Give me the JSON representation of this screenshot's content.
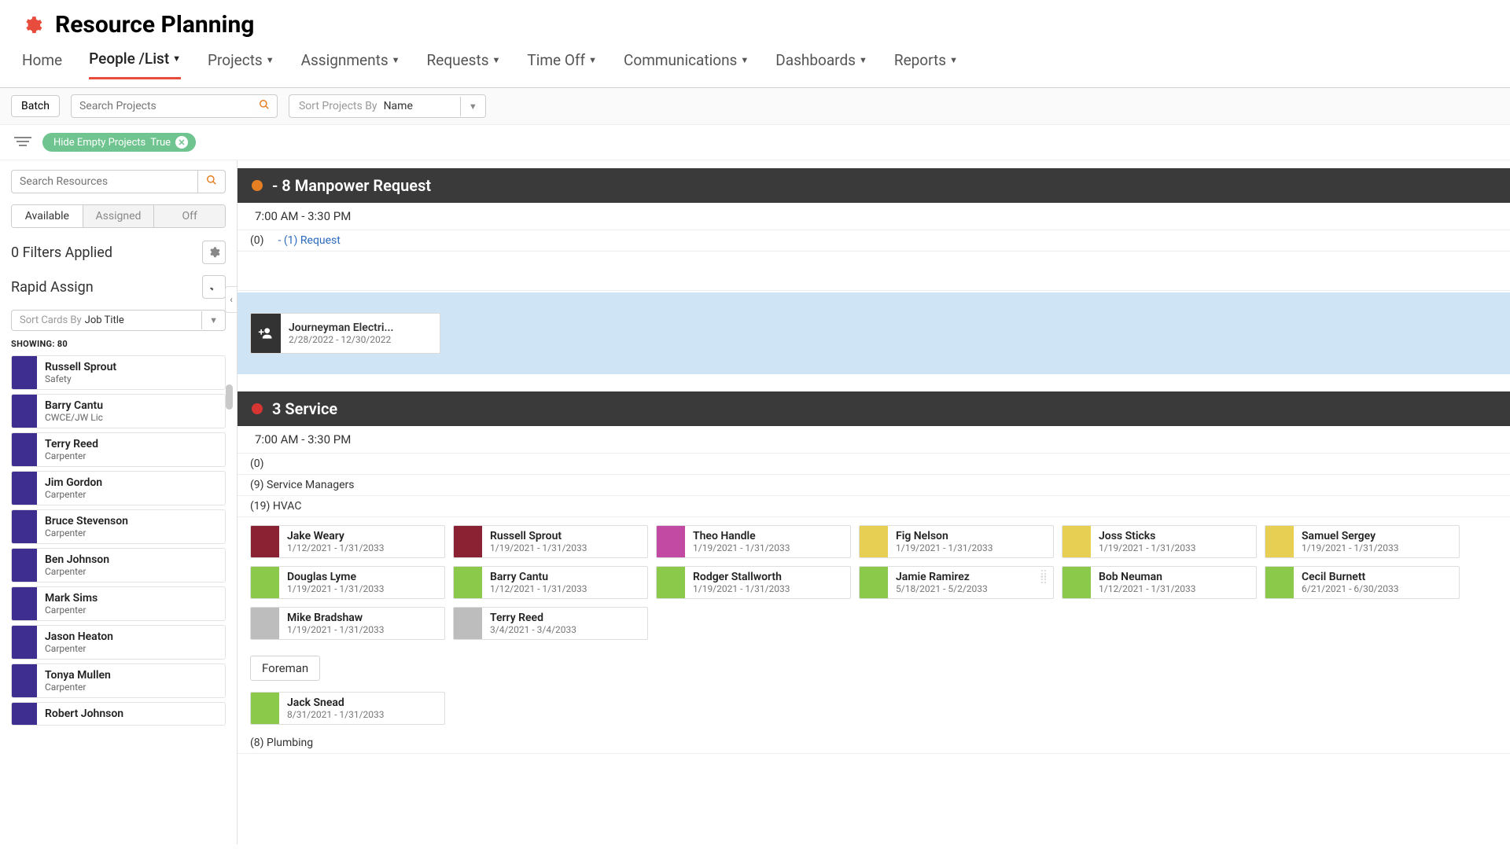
{
  "header": {
    "title": "Resource Planning"
  },
  "nav": {
    "items": [
      {
        "label": "Home",
        "dropdown": false
      },
      {
        "label": "People /List",
        "dropdown": true,
        "active": true
      },
      {
        "label": "Projects",
        "dropdown": true
      },
      {
        "label": "Assignments",
        "dropdown": true
      },
      {
        "label": "Requests",
        "dropdown": true
      },
      {
        "label": "Time Off",
        "dropdown": true
      },
      {
        "label": "Communications",
        "dropdown": true
      },
      {
        "label": "Dashboards",
        "dropdown": true
      },
      {
        "label": "Reports",
        "dropdown": true
      }
    ]
  },
  "toolbar": {
    "batch_label": "Batch",
    "search_projects_placeholder": "Search Projects",
    "sort_label": "Sort Projects By",
    "sort_value": "Name"
  },
  "filterbar": {
    "pill_label": "Hide Empty Projects",
    "pill_value": "True"
  },
  "sidebar": {
    "search_placeholder": "Search Resources",
    "segments": [
      "Available",
      "Assigned",
      "Off"
    ],
    "filters_label": "0 Filters Applied",
    "rapid_label": "Rapid Assign",
    "sort_label": "Sort Cards By",
    "sort_value": "Job Title",
    "showing_label": "SHOWING:",
    "showing_count": "80",
    "resources": [
      {
        "name": "Russell Sprout",
        "role": "Safety"
      },
      {
        "name": "Barry Cantu",
        "role": "CWCE/JW Lic"
      },
      {
        "name": "Terry Reed",
        "role": "Carpenter"
      },
      {
        "name": "Jim Gordon",
        "role": "Carpenter"
      },
      {
        "name": "Bruce Stevenson",
        "role": "Carpenter"
      },
      {
        "name": "Ben Johnson",
        "role": "Carpenter"
      },
      {
        "name": "Mark Sims",
        "role": "Carpenter"
      },
      {
        "name": "Jason Heaton",
        "role": "Carpenter"
      },
      {
        "name": "Tonya Mullen",
        "role": "Carpenter"
      },
      {
        "name": "Robert Johnson",
        "role": ""
      }
    ]
  },
  "groups": {
    "g1": {
      "title": "- 8 Manpower Request",
      "time": "7:00 AM - 3:30 PM",
      "count0": "(0)",
      "request_link": "- (1) Request",
      "request_card": {
        "title": "Journeyman Electri...",
        "dates": "2/28/2022 - 12/30/2022"
      }
    },
    "g2": {
      "title": "3 Service",
      "time": "7:00 AM - 3:30 PM",
      "count0": "(0)",
      "sm": "(9) Service Managers",
      "hvac": "(19) HVAC",
      "hvac_cards": [
        {
          "name": "Jake Weary",
          "dates": "1/12/2021 - 1/31/2033",
          "color": "c-maroon"
        },
        {
          "name": "Russell Sprout",
          "dates": "1/19/2021 - 1/31/2033",
          "color": "c-maroon"
        },
        {
          "name": "Theo Handle",
          "dates": "1/19/2021 - 1/31/2033",
          "color": "c-magenta"
        },
        {
          "name": "Fig Nelson",
          "dates": "1/19/2021 - 1/31/2033",
          "color": "c-yellow"
        },
        {
          "name": "Joss Sticks",
          "dates": "1/19/2021 - 1/31/2033",
          "color": "c-yellow"
        },
        {
          "name": "Samuel Sergey",
          "dates": "1/19/2021 - 1/31/2033",
          "color": "c-yellow"
        },
        {
          "name": "Douglas Lyme",
          "dates": "1/19/2021 - 1/31/2033",
          "color": "c-green"
        },
        {
          "name": "Barry Cantu",
          "dates": "1/12/2021 - 1/31/2033",
          "color": "c-green"
        },
        {
          "name": "Rodger Stallworth",
          "dates": "1/19/2021 - 1/31/2033",
          "color": "c-green"
        },
        {
          "name": "Jamie Ramirez",
          "dates": "5/18/2021 - 5/2/2033",
          "color": "c-green",
          "grip": true
        },
        {
          "name": "Bob Neuman",
          "dates": "1/12/2021 - 1/31/2033",
          "color": "c-green"
        },
        {
          "name": "Cecil Burnett",
          "dates": "6/21/2021 - 6/30/2033",
          "color": "c-green"
        },
        {
          "name": "Mike Bradshaw",
          "dates": "1/19/2021 - 1/31/2033",
          "color": "c-gray"
        },
        {
          "name": "Terry Reed",
          "dates": "3/4/2021 - 3/4/2033",
          "color": "c-gray"
        }
      ],
      "foreman_label": "Foreman",
      "foreman_cards": [
        {
          "name": "Jack Snead",
          "dates": "8/31/2021 - 1/31/2033",
          "color": "c-green"
        }
      ],
      "plumbing": "(8) Plumbing"
    }
  }
}
